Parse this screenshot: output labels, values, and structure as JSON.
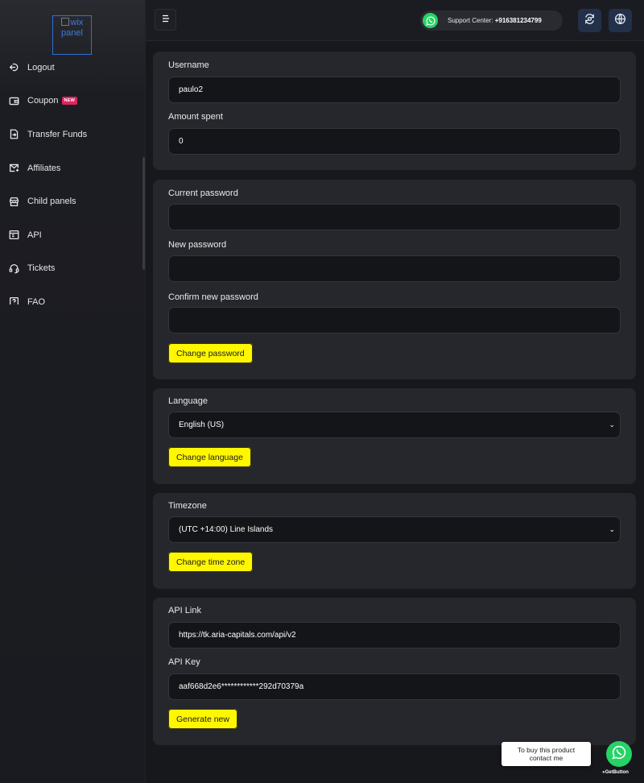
{
  "logo": {
    "alt_text": "wix panel"
  },
  "sidebar": {
    "items": [
      {
        "label": "Logout",
        "icon": "logout-icon"
      },
      {
        "label": "Coupon",
        "icon": "wallet-icon",
        "badge": "NEW"
      },
      {
        "label": "Transfer Funds",
        "icon": "file-transfer-icon"
      },
      {
        "label": "Affiliates",
        "icon": "mail-icon"
      },
      {
        "label": "Child panels",
        "icon": "store-icon"
      },
      {
        "label": "API",
        "icon": "browser-icon"
      },
      {
        "label": "Tickets",
        "icon": "headset-icon"
      },
      {
        "label": "FAQ",
        "icon": "question-icon"
      }
    ]
  },
  "header": {
    "menu_icon": "hamburger-icon",
    "support_label": "Support Center: ",
    "support_phone": "+916381234799",
    "currency_icon": "currency-exchange-icon",
    "language_icon": "globe-icon"
  },
  "account": {
    "username_label": "Username",
    "username_value": "paulo2",
    "amount_label": "Amount spent",
    "amount_value": "0"
  },
  "password": {
    "current_label": "Current password",
    "new_label": "New password",
    "confirm_label": "Confirm new password",
    "button": "Change password"
  },
  "language": {
    "label": "Language",
    "selected": "English (US)",
    "button": "Change language"
  },
  "timezone": {
    "label": "Timezone",
    "selected": "(UTC +14:00) Line Islands",
    "button": "Change time zone"
  },
  "api": {
    "link_label": "API Link",
    "link_value": "https://tk.aria-capitals.com/api/v2",
    "key_label": "API Key",
    "key_value": "aaf668d2e6************292d70379a",
    "button": "Generate new"
  },
  "widget": {
    "tooltip_line1": "To buy this product",
    "tooltip_line2": "contact me",
    "brand_prefix": "●",
    "brand_name": "GetButton"
  },
  "colors": {
    "accent_button": "#fff700",
    "whatsapp": "#25d366",
    "badge": "#e0245e"
  }
}
